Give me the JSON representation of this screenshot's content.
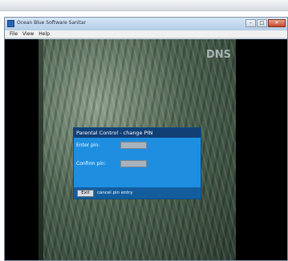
{
  "window": {
    "title": "Ocean Blue Software Sanitar"
  },
  "menubar": {
    "items": [
      "File",
      "View",
      "Help"
    ]
  },
  "video": {
    "channel_logo": "DNS"
  },
  "dialog": {
    "title": "Parental Control - change PIN",
    "enter_pin_label": "Enter pin:",
    "confirm_pin_label": "Confirm pin:",
    "enter_pin_value": "",
    "confirm_pin_value": "",
    "exit_label": "Exit",
    "exit_hint": "cancel pin entry"
  },
  "colors": {
    "dialog_body": "#1e8fe0",
    "dialog_title_bar": "#123f76",
    "dialog_footer": "#135d9e",
    "input_fill": "#a9b3bd"
  }
}
